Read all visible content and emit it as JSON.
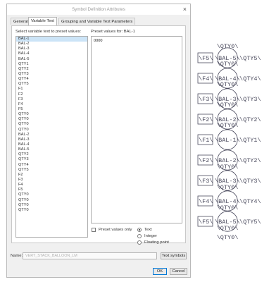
{
  "dialog": {
    "title": "Symbol Definition Attributes",
    "tabs": [
      "General",
      "Variable Text",
      "Grouping and Variable Text Parameters"
    ],
    "list_label": "Select variable text to preset values:",
    "preset_label": "Preset values for:  BAL-1",
    "items": [
      "BAL-1",
      "BAL-2",
      "BAL-3",
      "BAL-4",
      "BAL-5",
      "QTY1",
      "QTY2",
      "QTY3",
      "QTY4",
      "QTY5",
      "F1",
      "F2",
      "F3",
      "F4",
      "F5",
      "QTY0",
      "QTY0",
      "QTY0",
      "QTY0",
      "BAL-2",
      "BAL-3",
      "BAL-4",
      "BAL-5",
      "QTY2",
      "QTY3",
      "QTY4",
      "QTY5",
      "F2",
      "F3",
      "F4",
      "F5",
      "QTY0",
      "QTY0",
      "QTY0",
      "QTY0"
    ],
    "selected_index": 0,
    "preset_values": [
      "0000"
    ],
    "preset_only_label": "Preset values only",
    "radios": [
      "Text",
      "Integer",
      "Floating point"
    ],
    "radio_selected": 0,
    "name_label": "Name:",
    "name_value": "VERT_STACK_BALLOON_LM",
    "text_symbols_label": "Text symbols",
    "ok_label": "OK",
    "cancel_label": "Cancel",
    "close_glyph": "×"
  },
  "sketch": {
    "top_qty": "\\QTY0\\",
    "bottom_qty": "\\QTY0\\",
    "rows": [
      {
        "f": "\\F5\\",
        "bal": "\\BAL-5\\",
        "qty": "\\QTY5\\",
        "sub": "\\QTY0\\"
      },
      {
        "f": "\\F4\\",
        "bal": "\\BAL-4\\",
        "qty": "\\QTY4\\",
        "sub": "\\QTY0\\"
      },
      {
        "f": "\\F3\\",
        "bal": "\\BAL-3\\",
        "qty": "\\QTY3\\",
        "sub": "\\QTY0\\"
      },
      {
        "f": "\\F2\\",
        "bal": "\\BAL-2\\",
        "qty": "\\QTY2\\",
        "sub": "\\QTY0\\"
      },
      {
        "f": "\\F1\\",
        "bal": "\\BAL-1\\",
        "qty": "\\QTY1\\",
        "sub": ""
      },
      {
        "f": "\\F2\\",
        "bal": "\\BAL-2\\",
        "qty": "\\QTY2\\",
        "sub": "\\QTY0\\"
      },
      {
        "f": "\\F3\\",
        "bal": "\\BAL-3\\",
        "qty": "\\QTY3\\",
        "sub": "\\QTY0\\"
      },
      {
        "f": "\\F4\\",
        "bal": "\\BAL-4\\",
        "qty": "\\QTY4\\",
        "sub": "\\QTY0\\"
      },
      {
        "f": "\\F5\\",
        "bal": "\\BAL-5\\",
        "qty": "\\QTY5\\",
        "sub": "\\QTY0\\"
      }
    ]
  },
  "colors": {
    "sketch_ink": "#4b4b5e",
    "selection": "#cce4f7",
    "accent": "#0078d7"
  }
}
